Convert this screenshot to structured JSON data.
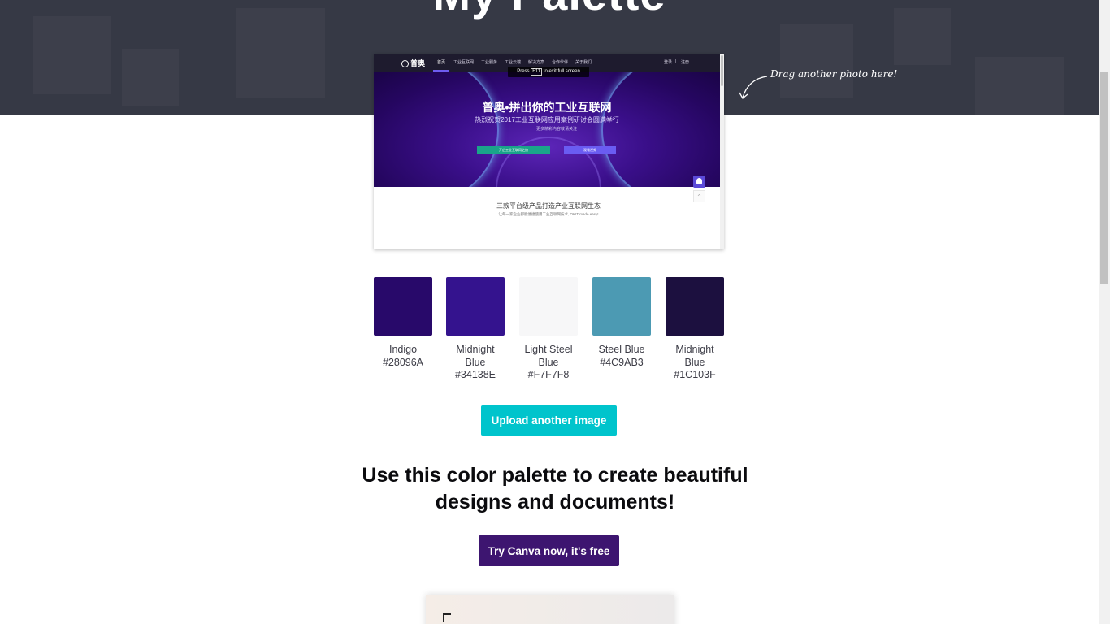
{
  "hero": {
    "title": "My Palette",
    "drag_hint": "Drag another photo here!"
  },
  "preview": {
    "logo": "普奥",
    "nav_items": [
      "首页",
      "工业互联网",
      "工业服务",
      "工业云端",
      "解决方案",
      "合作伙伴",
      "关于我们"
    ],
    "nav_right": [
      "登录",
      "|",
      "注册"
    ],
    "f11_prefix": "Press",
    "f11_key": "F11",
    "f11_suffix": "to exit full screen",
    "banner_title": "普奥•拼出你的工业互联网",
    "banner_subtitle": "热烈祝贺2017工业互联网应用案例研讨会圆满举行",
    "banner_note": "更多精彩内容敬请关注",
    "btn_primary": "开启工业互联网之旅",
    "btn_secondary": "观看视频",
    "section_title": "三款平台级产品打造产业互联网生态",
    "section_subtitle": "让每一家企业都能便捷使用工业互联网技术, OKIT made easy!"
  },
  "palette": [
    {
      "name": "Indigo",
      "hex": "#28096A",
      "color": "#28096A"
    },
    {
      "name": "Midnight Blue",
      "hex": "#34138E",
      "color": "#34138E"
    },
    {
      "name": "Light Steel Blue",
      "hex": "#F7F7F8",
      "color": "#F7F7F8"
    },
    {
      "name": "Steel Blue",
      "hex": "#4C9AB3",
      "color": "#4C9AB3"
    },
    {
      "name": "Midnight Blue",
      "hex": "#1C103F",
      "color": "#1C103F"
    }
  ],
  "actions": {
    "upload_label": "Upload another image",
    "cta_heading": "Use this color palette to create beautiful designs and documents!",
    "canva_label": "Try Canva now, it's free"
  },
  "colors": {
    "hero_bg": "#363945",
    "upload_btn": "#00C4CC",
    "canva_btn": "#3D1570"
  }
}
